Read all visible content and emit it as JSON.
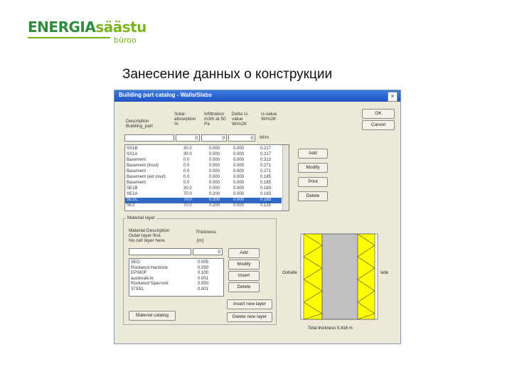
{
  "logo": {
    "part1": "ENERGIA",
    "part2": "säästu",
    "sub": "büroo"
  },
  "slide_title": "Занесение данных о конструкции",
  "dialog": {
    "title": "Building part catalog - Walls/Slabs",
    "close_glyph": "×",
    "headers": {
      "description": "Description Building_part",
      "solar": "Solar-absorption %",
      "infiltration": "Infiltration m3/h at 50 Pa",
      "delta": "Delta U-value W/m2K",
      "uvalue": "U-value W/m2K"
    },
    "filter_values": [
      "0",
      "0",
      "0"
    ],
    "filter_unit": "W/m",
    "ok_label": "OK",
    "cancel_label": "Cancel",
    "parts": [
      [
        "SS1B",
        "30.0",
        "0.000",
        "0.000",
        "0.217"
      ],
      [
        "SS1A",
        "30.0",
        "0.000",
        "0.000",
        "0.217"
      ],
      [
        "Basement",
        "0.0",
        "0.000",
        "0.000",
        "0.313"
      ],
      [
        "Basement (insul)",
        "0.0",
        "0.000",
        "0.000",
        "0.271"
      ],
      [
        "Basement",
        "0.0",
        "0.000",
        "0.000",
        "0.271"
      ],
      [
        "Basement (ext insul)",
        "0.0",
        "0.000",
        "0.000",
        "0.185"
      ],
      [
        "Basement",
        "0.0",
        "0.000",
        "0.000",
        "0.185"
      ],
      [
        "SE1B",
        "30.0",
        "0.000",
        "0.000",
        "0.183"
      ],
      [
        "SE1A",
        "70.0",
        "0.200",
        "0.000",
        "0.183"
      ],
      [
        "SE1C",
        "70.0",
        "0.200",
        "0.000",
        "0.183"
      ],
      [
        "SE2",
        "70.0",
        "0.200",
        "0.000",
        "0.125"
      ]
    ],
    "selected_index": 9,
    "add_label": "Add",
    "modify_label": "Modify",
    "print_label": "Print",
    "delete_label": "Delete",
    "layers": {
      "group_label": "Material layer",
      "desc_lines": [
        "Material Description",
        "Outer layer first.",
        "No cell layer here."
      ],
      "thickness_label": "Thickness",
      "thickness_unit": "[m]",
      "thickness_value": "0",
      "items": [
        [
          "SEO",
          "0.005"
        ],
        [
          "Rockwool Hardrock",
          "0.050"
        ],
        [
          "EPS60F",
          "0.100"
        ],
        [
          "austevaik.le",
          "0.001"
        ],
        [
          "Rockwool Spacrock",
          "0.050"
        ],
        [
          "STEEL",
          "0.001"
        ]
      ],
      "add_label": "Add",
      "modify_label": "Modify",
      "insert_label": "Insert",
      "delete_label": "Delete",
      "catalog_button": "Material catalog",
      "insert_layer_button": "Insert new layer",
      "delete_layer_button": "Delete new layer"
    },
    "diagram": {
      "outside_label": "Outside",
      "inside_label": "side",
      "total_label": "Total thickness 0.416 m",
      "colors": {
        "insulation": "#ffff00",
        "core": "#c0c0c0",
        "panel": "#ffffff"
      }
    }
  }
}
